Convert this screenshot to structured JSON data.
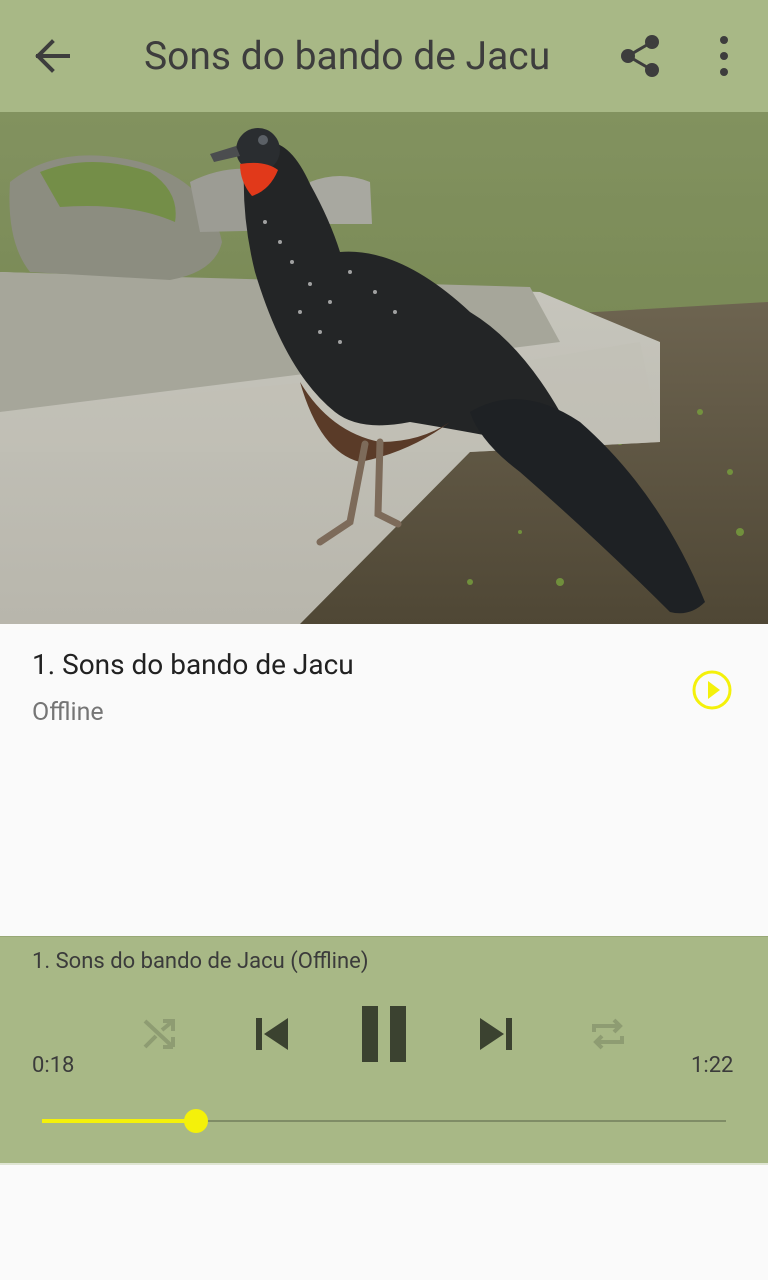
{
  "appbar": {
    "title": "Sons do bando de Jacu",
    "icons": {
      "back": "arrow-back-icon",
      "share": "share-icon",
      "more": "more-vert-icon"
    }
  },
  "hero": {
    "description_icon": "bird-photo"
  },
  "track": {
    "title": "1. Sons do bando de Jacu",
    "subtitle": "Offline",
    "play_icon": "play-circle-icon"
  },
  "player": {
    "now_playing": "1. Sons do bando de Jacu (Offline)",
    "elapsed": "0:18",
    "duration": "1:22",
    "progress_percent": 22.5,
    "controls": [
      "shuffle-icon",
      "skip-previous-icon",
      "pause-icon",
      "skip-next-icon",
      "repeat-icon"
    ]
  },
  "colors": {
    "appbar_bg": "#a8b886",
    "accent": "#f4f10a",
    "icon_dark": "#3d3d3d",
    "icon_muted": "#8e9c72"
  }
}
